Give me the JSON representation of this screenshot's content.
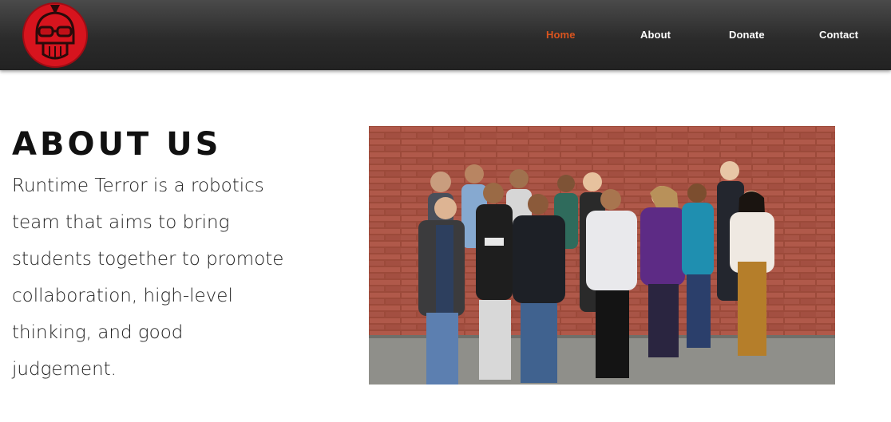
{
  "header": {
    "nav": [
      {
        "label": "Home",
        "active": true
      },
      {
        "label": "About",
        "active": false
      },
      {
        "label": "Donate",
        "active": false
      },
      {
        "label": "Contact",
        "active": false
      }
    ]
  },
  "main": {
    "title": "ABOUT US",
    "description": "Runtime Terror is a robotics team that aims to bring students together to promote collaboration, high-level thinking, and good judgement."
  },
  "colors": {
    "accent": "#d9541e",
    "header_bg": "#2b2b2b",
    "logo_red": "#d7141e"
  }
}
